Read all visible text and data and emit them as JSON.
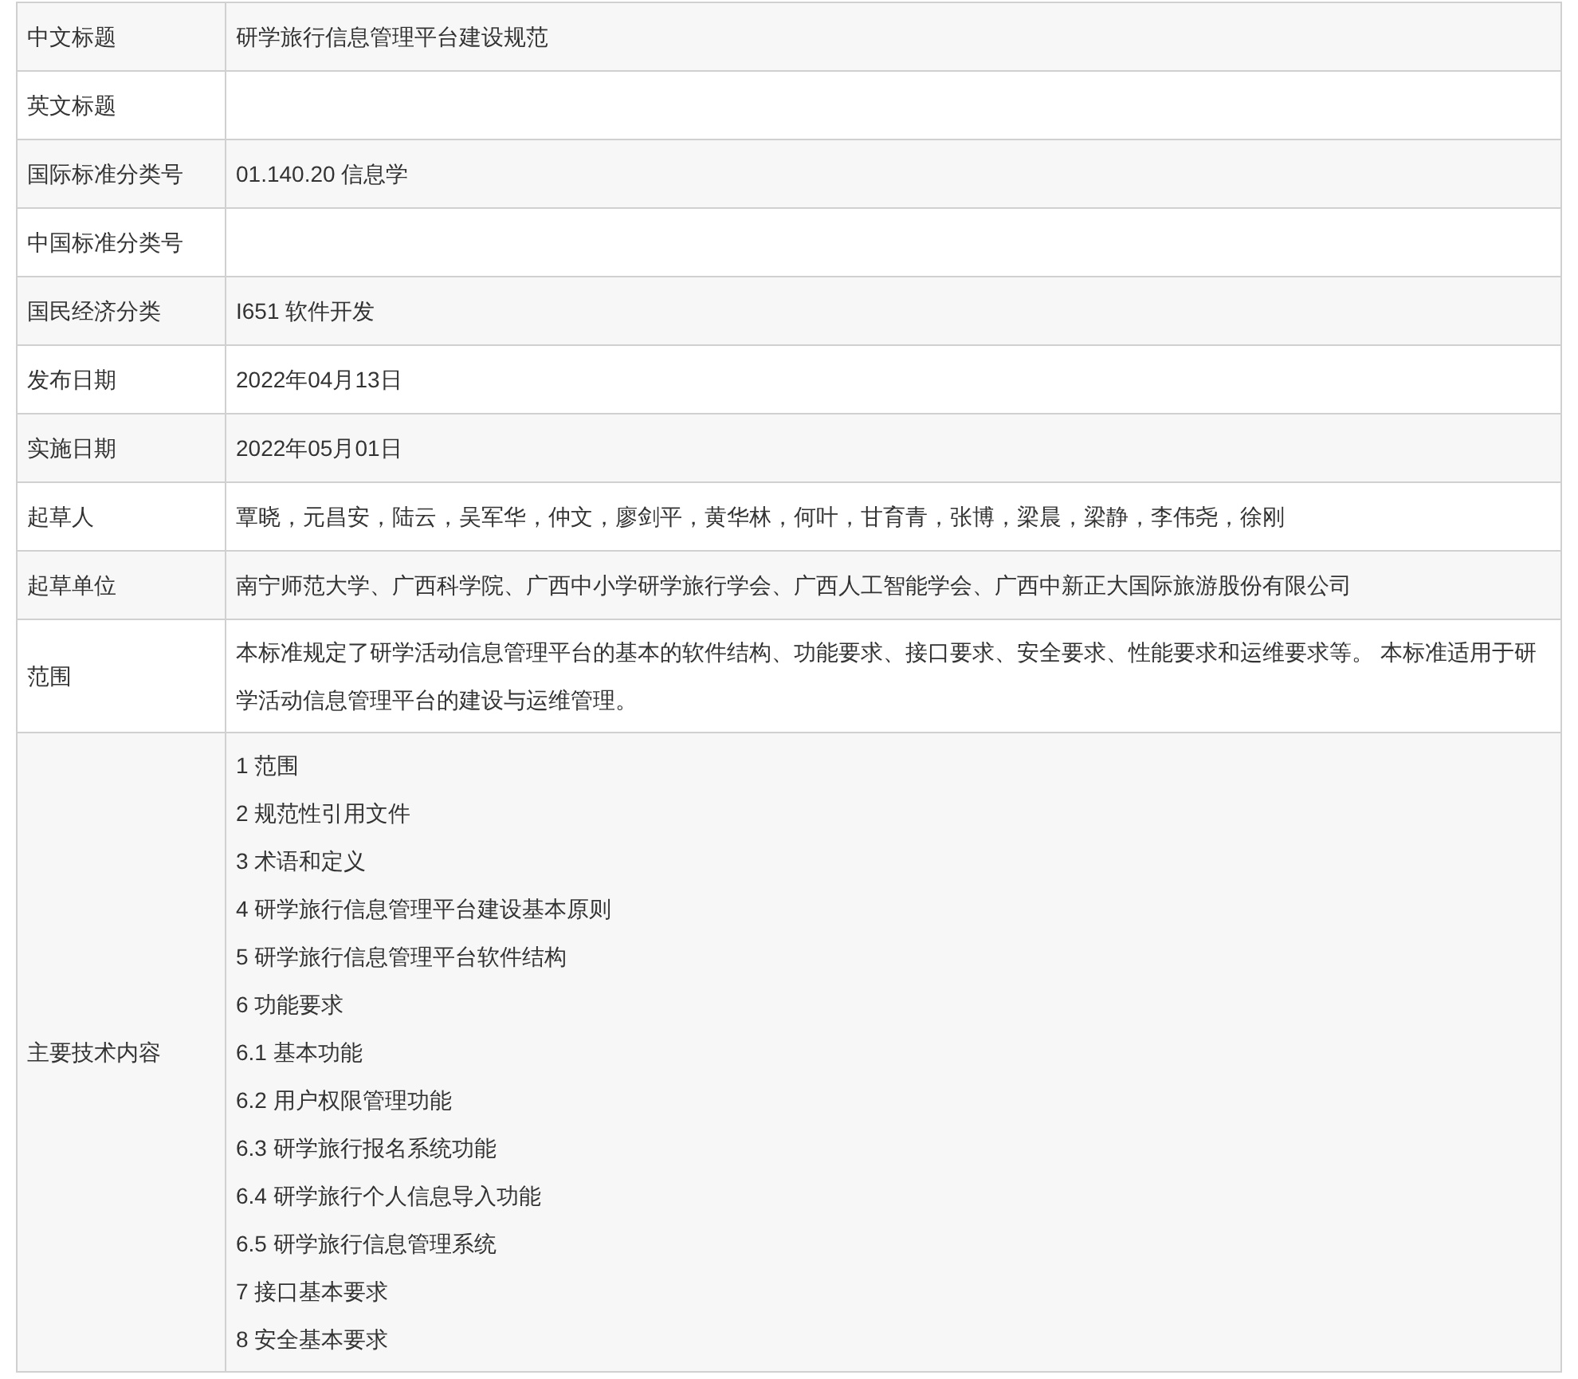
{
  "rows": [
    {
      "label": "中文标题",
      "kind": "text",
      "value": "研学旅行信息管理平台建设规范"
    },
    {
      "label": "英文标题",
      "kind": "empty"
    },
    {
      "label": "国际标准分类号",
      "kind": "text",
      "value": "01.140.20 信息学"
    },
    {
      "label": "中国标准分类号",
      "kind": "empty"
    },
    {
      "label": "国民经济分类",
      "kind": "text",
      "value": "I651 软件开发"
    },
    {
      "label": "发布日期",
      "kind": "text",
      "value": "2022年04月13日"
    },
    {
      "label": "实施日期",
      "kind": "text",
      "value": "2022年05月01日"
    },
    {
      "label": "起草人",
      "kind": "text",
      "value": "覃晓，元昌安，陆云，吴军华，仲文，廖剑平，黄华林，何叶，甘育青，张博，梁晨，梁静，李伟尧，徐刚"
    },
    {
      "label": "起草单位",
      "kind": "text",
      "value": "南宁师范大学、广西科学院、广西中小学研学旅行学会、广西人工智能学会、广西中新正大国际旅游股份有限公司"
    },
    {
      "label": "范围",
      "kind": "paragraph",
      "value": "本标准规定了研学活动信息管理平台的基本的软件结构、功能要求、接口要求、安全要求、性能要求和运维要求等。 本标准适用于研学活动信息管理平台的建设与运维管理。"
    },
    {
      "label": "主要技术内容",
      "kind": "list",
      "items": [
        "1 范围",
        "2 规范性引用文件",
        "3 术语和定义",
        "4 研学旅行信息管理平台建设基本原则",
        "5 研学旅行信息管理平台软件结构",
        "6 功能要求",
        "6.1 基本功能",
        "6.2 用户权限管理功能",
        "6.3 研学旅行报名系统功能",
        "6.4 研学旅行个人信息导入功能",
        "6.5 研学旅行信息管理系统",
        "7 接口基本要求",
        "8 安全基本要求"
      ]
    }
  ]
}
